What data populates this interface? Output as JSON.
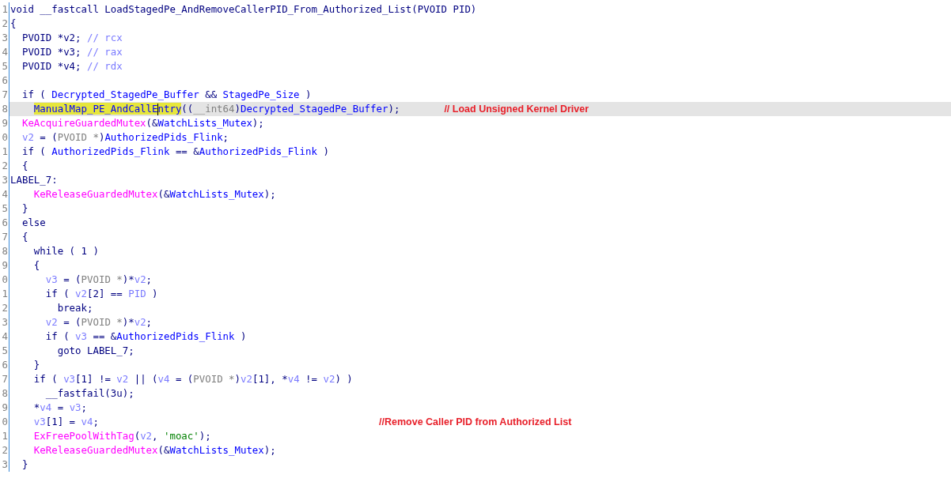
{
  "lines": [
    {
      "number": "1",
      "selected": false,
      "tokens": [
        {
          "text": "void __fastcall LoadStagedPe_AndRemoveCallerPID_From_Authorized_List(PVOID PID)",
          "kind": "plain"
        }
      ]
    },
    {
      "number": "2",
      "selected": false,
      "tokens": [
        {
          "text": "{",
          "kind": "plain"
        }
      ]
    },
    {
      "number": "3",
      "selected": false,
      "tokens": [
        {
          "text": "  PVOID *v2; ",
          "kind": "plain"
        },
        {
          "text": "// rcx",
          "kind": "local"
        }
      ]
    },
    {
      "number": "4",
      "selected": false,
      "tokens": [
        {
          "text": "  PVOID *v3; ",
          "kind": "plain"
        },
        {
          "text": "// rax",
          "kind": "local"
        }
      ]
    },
    {
      "number": "5",
      "selected": false,
      "tokens": [
        {
          "text": "  PVOID *v4; ",
          "kind": "plain"
        },
        {
          "text": "// rdx",
          "kind": "local"
        }
      ]
    },
    {
      "number": "6",
      "selected": false
    },
    {
      "number": "7",
      "selected": false,
      "tokens": [
        {
          "text": "  if ( ",
          "kind": "plain"
        },
        {
          "text": "Decrypted_StagedPe_Buffer",
          "kind": "global"
        },
        {
          "text": " && ",
          "kind": "plain"
        },
        {
          "text": "StagedPe_Size",
          "kind": "global"
        },
        {
          "text": " )",
          "kind": "plain"
        }
      ]
    },
    {
      "number": "8",
      "selected": true,
      "tokens": [
        {
          "text": "    ManualMap_PE_AndCallE",
          "kind": "highlight"
        },
        {
          "kind": "cursor"
        },
        {
          "text": "ntry",
          "kind": "highlight"
        },
        {
          "text": "((",
          "kind": "plain"
        },
        {
          "text": "__int64",
          "kind": "type"
        },
        {
          "text": ")",
          "kind": "plain"
        },
        {
          "text": "Decrypted_StagedPe_Buffer",
          "kind": "global"
        },
        {
          "text": ");",
          "kind": "plain"
        }
      ],
      "annotation": "// Load Unsigned Kernel Driver"
    },
    {
      "number": "9",
      "selected": false,
      "tokens": [
        {
          "text": "  KeAcquireGuardedMutex",
          "kind": "import"
        },
        {
          "text": "(&",
          "kind": "plain"
        },
        {
          "text": "WatchLists_Mutex",
          "kind": "global"
        },
        {
          "text": ");",
          "kind": "plain"
        }
      ]
    },
    {
      "number": "0",
      "selected": false,
      "tokens": [
        {
          "text": "  v2",
          "kind": "local"
        },
        {
          "text": " = (",
          "kind": "plain"
        },
        {
          "text": "PVOID *",
          "kind": "type"
        },
        {
          "text": ")",
          "kind": "plain"
        },
        {
          "text": "AuthorizedPids_Flink",
          "kind": "global"
        },
        {
          "text": ";",
          "kind": "plain"
        }
      ]
    },
    {
      "number": "1",
      "selected": false,
      "tokens": [
        {
          "text": "  if ( ",
          "kind": "plain"
        },
        {
          "text": "AuthorizedPids_Flink",
          "kind": "global"
        },
        {
          "text": " == &",
          "kind": "plain"
        },
        {
          "text": "AuthorizedPids_Flink",
          "kind": "global"
        },
        {
          "text": " )",
          "kind": "plain"
        }
      ]
    },
    {
      "number": "2",
      "selected": false,
      "tokens": [
        {
          "text": "  {",
          "kind": "plain"
        }
      ]
    },
    {
      "number": "3",
      "selected": false,
      "tokens": [
        {
          "text": "LABEL_7:",
          "kind": "plain"
        }
      ]
    },
    {
      "number": "4",
      "selected": false,
      "tokens": [
        {
          "text": "    KeReleaseGuardedMutex",
          "kind": "import"
        },
        {
          "text": "(&",
          "kind": "plain"
        },
        {
          "text": "WatchLists_Mutex",
          "kind": "global"
        },
        {
          "text": ");",
          "kind": "plain"
        }
      ]
    },
    {
      "number": "5",
      "selected": false,
      "tokens": [
        {
          "text": "  }",
          "kind": "plain"
        }
      ]
    },
    {
      "number": "6",
      "selected": false,
      "tokens": [
        {
          "text": "  else",
          "kind": "plain"
        }
      ]
    },
    {
      "number": "7",
      "selected": false,
      "tokens": [
        {
          "text": "  {",
          "kind": "plain"
        }
      ]
    },
    {
      "number": "8",
      "selected": false,
      "tokens": [
        {
          "text": "    while ( 1 )",
          "kind": "plain"
        }
      ]
    },
    {
      "number": "9",
      "selected": false,
      "tokens": [
        {
          "text": "    {",
          "kind": "plain"
        }
      ]
    },
    {
      "number": "0",
      "selected": false,
      "tokens": [
        {
          "text": "      v3",
          "kind": "local"
        },
        {
          "text": " = (",
          "kind": "plain"
        },
        {
          "text": "PVOID *",
          "kind": "type"
        },
        {
          "text": ")*",
          "kind": "plain"
        },
        {
          "text": "v2",
          "kind": "local"
        },
        {
          "text": ";",
          "kind": "plain"
        }
      ]
    },
    {
      "number": "1",
      "selected": false,
      "tokens": [
        {
          "text": "      if ( ",
          "kind": "plain"
        },
        {
          "text": "v2",
          "kind": "local"
        },
        {
          "text": "[2] == ",
          "kind": "plain"
        },
        {
          "text": "PID",
          "kind": "local"
        },
        {
          "text": " )",
          "kind": "plain"
        }
      ]
    },
    {
      "number": "2",
      "selected": false,
      "tokens": [
        {
          "text": "        break;",
          "kind": "plain"
        }
      ]
    },
    {
      "number": "3",
      "selected": false,
      "tokens": [
        {
          "text": "      v2",
          "kind": "local"
        },
        {
          "text": " = (",
          "kind": "plain"
        },
        {
          "text": "PVOID *",
          "kind": "type"
        },
        {
          "text": ")*",
          "kind": "plain"
        },
        {
          "text": "v2",
          "kind": "local"
        },
        {
          "text": ";",
          "kind": "plain"
        }
      ]
    },
    {
      "number": "4",
      "selected": false,
      "tokens": [
        {
          "text": "      if ( ",
          "kind": "plain"
        },
        {
          "text": "v3",
          "kind": "local"
        },
        {
          "text": " == &",
          "kind": "plain"
        },
        {
          "text": "AuthorizedPids_Flink",
          "kind": "global"
        },
        {
          "text": " )",
          "kind": "plain"
        }
      ]
    },
    {
      "number": "5",
      "selected": false,
      "tokens": [
        {
          "text": "        goto LABEL_7;",
          "kind": "plain"
        }
      ]
    },
    {
      "number": "6",
      "selected": false,
      "tokens": [
        {
          "text": "    }",
          "kind": "plain"
        }
      ]
    },
    {
      "number": "7",
      "selected": false,
      "tokens": [
        {
          "text": "    if ( ",
          "kind": "plain"
        },
        {
          "text": "v3",
          "kind": "local"
        },
        {
          "text": "[1] != ",
          "kind": "plain"
        },
        {
          "text": "v2",
          "kind": "local"
        },
        {
          "text": " || (",
          "kind": "plain"
        },
        {
          "text": "v4",
          "kind": "local"
        },
        {
          "text": " = (",
          "kind": "plain"
        },
        {
          "text": "PVOID *",
          "kind": "type"
        },
        {
          "text": ")",
          "kind": "plain"
        },
        {
          "text": "v2",
          "kind": "local"
        },
        {
          "text": "[1], *",
          "kind": "plain"
        },
        {
          "text": "v4",
          "kind": "local"
        },
        {
          "text": " != ",
          "kind": "plain"
        },
        {
          "text": "v2",
          "kind": "local"
        },
        {
          "text": ") )",
          "kind": "plain"
        }
      ]
    },
    {
      "number": "8",
      "selected": false,
      "tokens": [
        {
          "text": "      __fastfail(3u);",
          "kind": "plain"
        }
      ]
    },
    {
      "number": "9",
      "selected": false,
      "tokens": [
        {
          "text": "    *",
          "kind": "plain"
        },
        {
          "text": "v4",
          "kind": "local"
        },
        {
          "text": " = ",
          "kind": "plain"
        },
        {
          "text": "v3",
          "kind": "local"
        },
        {
          "text": ";",
          "kind": "plain"
        }
      ]
    },
    {
      "number": "0",
      "selected": false,
      "tokens": [
        {
          "text": "    v3",
          "kind": "local"
        },
        {
          "text": "[1] = ",
          "kind": "plain"
        },
        {
          "text": "v4",
          "kind": "local"
        },
        {
          "text": ";",
          "kind": "plain"
        }
      ],
      "annotation": "//Remove Caller PID from Authorized List"
    },
    {
      "number": "1",
      "selected": false,
      "tokens": [
        {
          "text": "    ExFreePoolWithTag",
          "kind": "import"
        },
        {
          "text": "(",
          "kind": "plain"
        },
        {
          "text": "v2",
          "kind": "local"
        },
        {
          "text": ", ",
          "kind": "plain"
        },
        {
          "text": "'moac'",
          "kind": "string"
        },
        {
          "text": ");",
          "kind": "plain"
        }
      ]
    },
    {
      "number": "2",
      "selected": false,
      "tokens": [
        {
          "text": "    KeReleaseGuardedMutex",
          "kind": "import"
        },
        {
          "text": "(&",
          "kind": "plain"
        },
        {
          "text": "WatchLists_Mutex",
          "kind": "global"
        },
        {
          "text": ");",
          "kind": "plain"
        }
      ]
    },
    {
      "number": "3",
      "selected": false,
      "tokens": [
        {
          "text": "  }",
          "kind": "plain"
        }
      ]
    }
  ]
}
